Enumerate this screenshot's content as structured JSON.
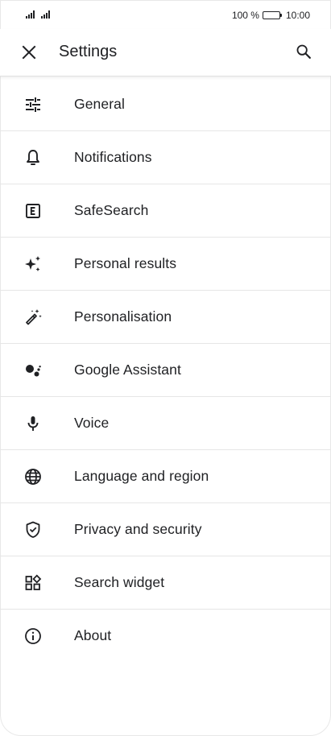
{
  "status_bar": {
    "battery_percent": "100 %",
    "battery_level": 1.0,
    "time": "10:00"
  },
  "app_bar": {
    "title": "Settings"
  },
  "settings": {
    "items": [
      {
        "label": "General",
        "icon": "tune-icon"
      },
      {
        "label": "Notifications",
        "icon": "bell-icon"
      },
      {
        "label": "SafeSearch",
        "icon": "explicit-icon"
      },
      {
        "label": "Personal results",
        "icon": "sparkle-icon"
      },
      {
        "label": "Personalisation",
        "icon": "magic-wand-icon"
      },
      {
        "label": "Google Assistant",
        "icon": "assistant-icon"
      },
      {
        "label": "Voice",
        "icon": "microphone-icon"
      },
      {
        "label": "Language and region",
        "icon": "globe-icon"
      },
      {
        "label": "Privacy and security",
        "icon": "shield-check-icon"
      },
      {
        "label": "Search widget",
        "icon": "widgets-icon"
      },
      {
        "label": "About",
        "icon": "info-icon"
      }
    ]
  },
  "colors": {
    "text": "#202124",
    "divider": "#e6e6e6",
    "background": "#ffffff"
  }
}
